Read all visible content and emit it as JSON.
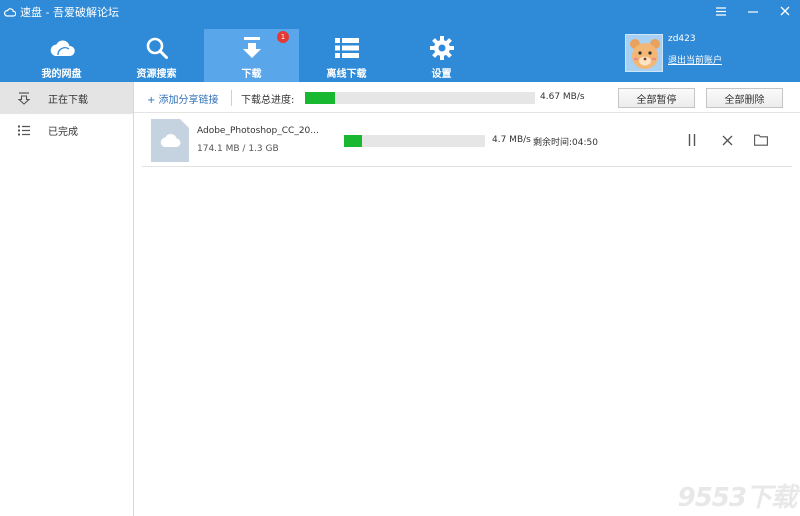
{
  "window": {
    "title": "速盘 - 吾爱破解论坛",
    "controls": [
      "menu-icon",
      "minimize-icon",
      "close-icon"
    ]
  },
  "nav": {
    "items": [
      {
        "label": "我的网盘",
        "icon": "cloud-icon"
      },
      {
        "label": "资源搜索",
        "icon": "search-icon"
      },
      {
        "label": "下载",
        "icon": "download-icon",
        "badge": "1",
        "active": true
      },
      {
        "label": "离线下载",
        "icon": "list-icon"
      },
      {
        "label": "设置",
        "icon": "gear-icon"
      }
    ]
  },
  "user": {
    "name": "zd423",
    "logout_label": "退出当前账户"
  },
  "sidebar": {
    "items": [
      {
        "label": "正在下载",
        "icon": "downloading-icon",
        "active": true
      },
      {
        "label": "已完成",
        "icon": "list-icon"
      }
    ]
  },
  "toolbar": {
    "add_link_label": "+ 添加分享链接",
    "total_label": "下载总进度:",
    "total_progress": 0.13,
    "total_speed": "4.67 MB/s",
    "pause_all_label": "全部暂停",
    "delete_all_label": "全部删除"
  },
  "tasks": [
    {
      "name": "Adobe_Photoshop_CC_20...",
      "size": "174.1 MB / 1.3 GB",
      "progress": 0.13,
      "speed": "4.7 MB/s",
      "remaining": "剩余时间:04:50"
    }
  ],
  "watermark": "9553下载",
  "colors": {
    "header_bg": "#2f8ad7",
    "nav_active_bg": "#5aa6ea",
    "progress_fill": "#18b830",
    "badge": "#e53935",
    "link": "#2f6fb8"
  }
}
